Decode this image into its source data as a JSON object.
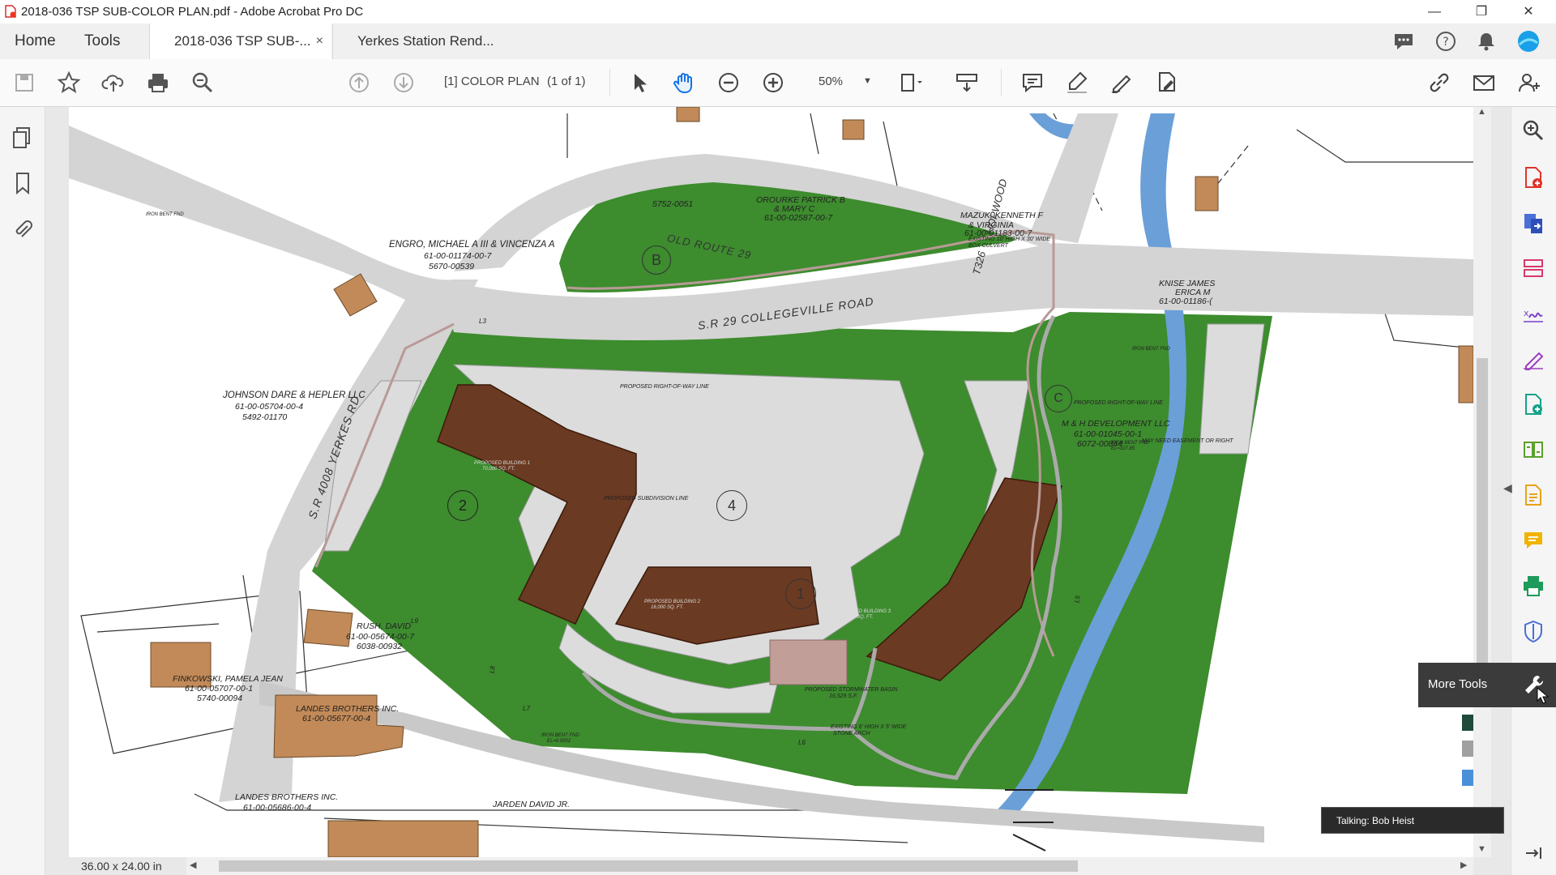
{
  "window": {
    "title": "2018-036 TSP SUB-COLOR PLAN.pdf - Adobe Acrobat Pro DC",
    "controls": [
      "minimize",
      "restore",
      "close"
    ]
  },
  "tabs": {
    "home": "Home",
    "tools": "Tools",
    "documents": [
      {
        "label": "2018-036 TSP SUB-...",
        "active": true,
        "close": "×"
      },
      {
        "label": "Yerkes Station Rend...",
        "active": false
      }
    ]
  },
  "toolbar": {
    "page_label": "[1] COLOR PLAN",
    "page_count": "(1 of 1)",
    "zoom": "50%"
  },
  "plan": {
    "road_main": "S.R 29 COLLEGEVILLE ROAD",
    "road_old": "OLD ROUTE 29",
    "road_yerkes": "S.R 4008 YERKES RD.",
    "road_hopwood": "HOPWOOD",
    "road_t326": "T326",
    "row_line": "PROPOSED RIGHT-OF-WAY LINE",
    "row_line_2": "PROPOSED RIGHT-OF-WAY LINE",
    "labels": {
      "engro": [
        "ENGRO, MICHAEL A III & VINCENZA A",
        "61-00-01174-00-7",
        "5670-00539"
      ],
      "orourke": [
        "OROURKE PATRICK B",
        "& MARY C",
        "61-00-02587-00-7"
      ],
      "top_parcel": [
        "5752-0051"
      ],
      "mazuk": [
        "MAZUK, KENNETH F",
        "& VIRGINIA",
        "61-00-01183-00-7"
      ],
      "culvert": [
        "EXISTING 10' HIGH X 30' WIDE",
        "BOX CULVERT"
      ],
      "knise": [
        "KNISE JAMES",
        "ERICA M",
        "61-00-01186-("
      ],
      "johnson": [
        "JOHNSON DARE & HEPLER LLC",
        "61-00-05704-00-4",
        "5492-01170"
      ],
      "mh": [
        "M & H DEVELOPMENT LLC",
        "61-00-01045-00-1",
        "6072-00844"
      ],
      "easement": "MAY NEED EASEMENT OR RIGHT",
      "rush": [
        "RUSH, DAVID",
        "61-00-05674-00-7",
        "6038-00932"
      ],
      "finkowski": [
        "FINKOWSKI, PAMELA JEAN",
        "61-00-05707-00-1",
        "5740-00094"
      ],
      "landes1": [
        "LANDES BROTHERS INC.",
        "61-00-05677-00-4"
      ],
      "landes2": [
        "LANDES BROTHERS INC.",
        "61-00-05686-00-4"
      ],
      "jarden": "JARDEN DAVID JR.",
      "stormwater": [
        "PROPOSED STORMWATER BASIN",
        "16,529 S.F."
      ],
      "arch": [
        "EXISTING 6' HIGH X 5' WIDE",
        "STONE ARCH"
      ],
      "bldg1": [
        "PROPOSED BUILDING 1",
        "70,000 SQ. FT."
      ],
      "bldg2": [
        "PROPOSED BUILDING 2",
        "16,000 SQ. FT."
      ],
      "bldg3": [
        "PROPOSED BUILDING 3",
        "17,000 SQ. FT."
      ],
      "subdivision": "PROPOSED SUBDIVISION LINE",
      "iron_pin_1": [
        "IRON BENT FND",
        "EL=107.85"
      ],
      "iron_pin_2": [
        "IRON BENT FND",
        "EL=0.0052"
      ],
      "iron_pin_3": [
        "IRON BENT FND"
      ],
      "circles": [
        "B",
        "2",
        "4",
        "1",
        "C"
      ],
      "line_labels": [
        "L3",
        "L5",
        "L6",
        "L7",
        "L8",
        "L9"
      ]
    }
  },
  "right_tools": [
    "search-zoom",
    "create-pdf",
    "export-pdf",
    "organize-pages",
    "fill-sign",
    "edit-pdf",
    "send-for-review",
    "compare",
    "combine",
    "comment",
    "print-production",
    "protect"
  ],
  "more_tools": "More Tools",
  "talking": "Talking: Bob Heist",
  "page_size": "36.00 x 24.00 in",
  "colors": {
    "grass": "#3d8c2e",
    "building": "#6b3a22",
    "stream": "#6a9fd8",
    "road": "#d4d4d4",
    "trail": "#b89a96",
    "accent": "#1473e6"
  }
}
